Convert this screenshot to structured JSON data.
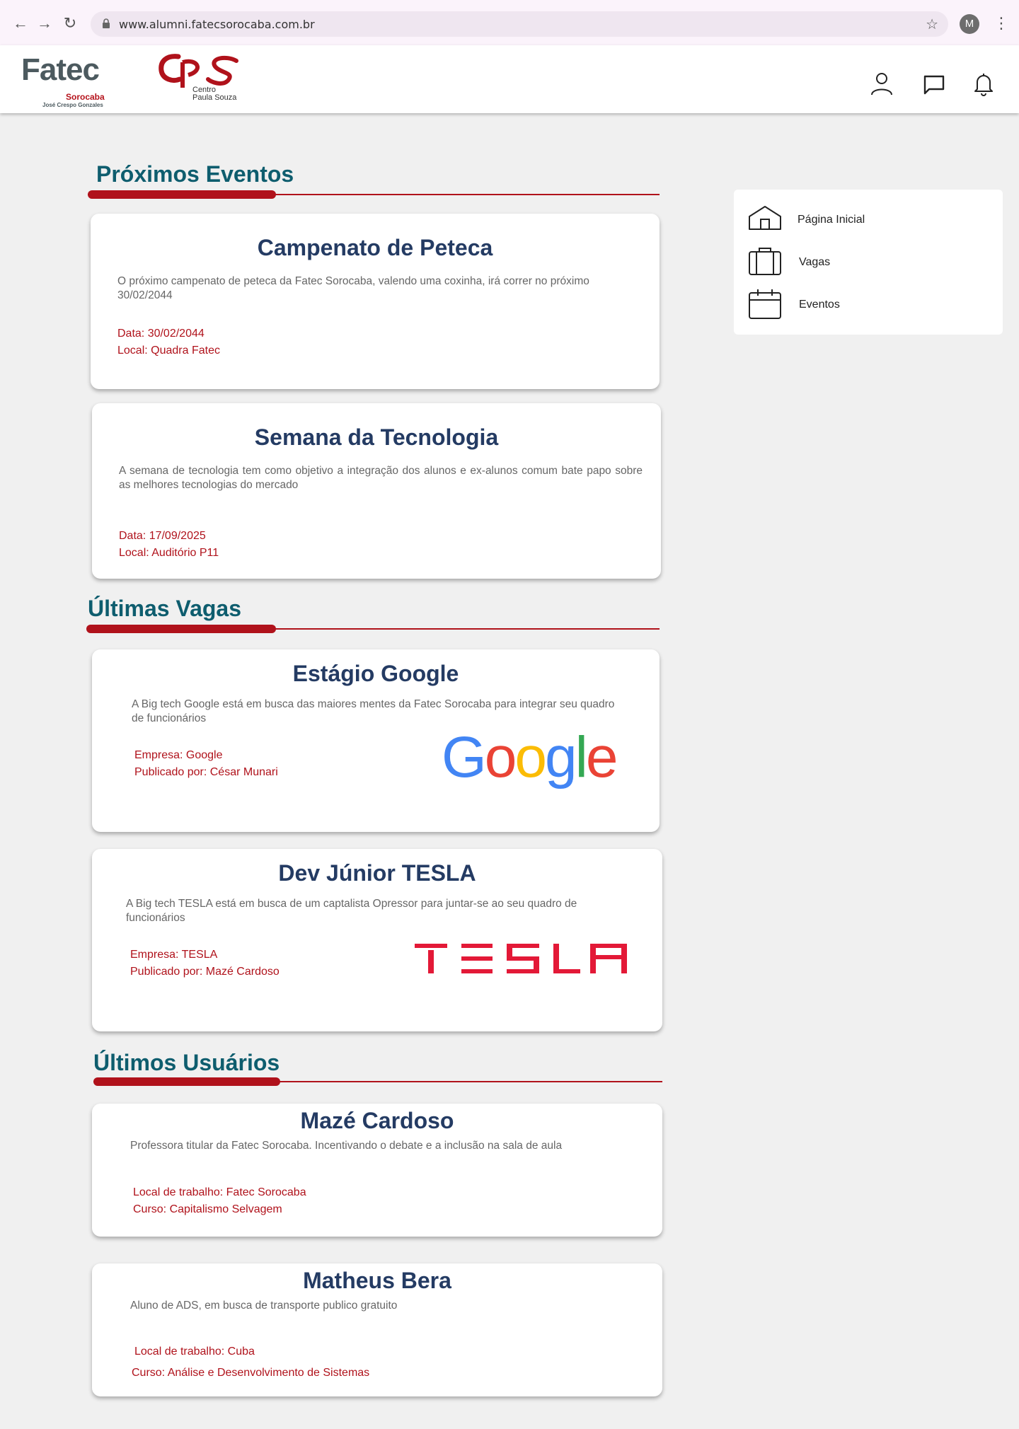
{
  "browser": {
    "url": "www.alumni.fatecsorocaba.com.br",
    "profile_initial": "M"
  },
  "header": {
    "fatec_logo_word": "Fatec",
    "fatec_logo_city": "Sorocaba",
    "fatec_logo_sub": "José Crespo Gonzales",
    "cps_logo_caption_1": "Centro",
    "cps_logo_caption_2": "Paula Souza",
    "icons": [
      "user-icon",
      "chat-icon",
      "bell-icon"
    ]
  },
  "sidebar": {
    "items": [
      {
        "label": "Página Inicial",
        "icon": "home-icon"
      },
      {
        "label": "Vagas",
        "icon": "briefcase-icon"
      },
      {
        "label": "Eventos",
        "icon": "calendar-icon"
      }
    ]
  },
  "events": {
    "title": "Próximos Eventos",
    "items": [
      {
        "title": "Campenato de Peteca",
        "description": "O próximo campenato de peteca da Fatec Sorocaba, valendo uma coxinha, irá correr no próximo 30/02/2044",
        "date": "Data: 30/02/2044",
        "location": "Local: Quadra Fatec"
      },
      {
        "title": "Semana da Tecnologia",
        "description": "A semana de tecnologia tem como objetivo a integração dos alunos e ex-alunos comum bate papo sobre as melhores tecnologias do mercado",
        "date": "Data: 17/09/2025",
        "location": "Local: Auditório P11"
      }
    ]
  },
  "jobs": {
    "title": "Últimas Vagas",
    "items": [
      {
        "title": "Estágio Google",
        "description": "A Big tech Google está em busca das maiores mentes da Fatec Sorocaba para integrar seu quadro de funcionários",
        "company": "Empresa: Google",
        "published_by": "Publicado por: César Munari",
        "logo_text": "Google"
      },
      {
        "title": "Dev Júnior TESLA",
        "description": "A Big tech TESLA está em busca de um captalista Opressor para juntar-se ao seu quadro de funcionários",
        "company": "Empresa: TESLA",
        "published_by": "Publicado por: Mazé Cardoso",
        "logo_text": "TESLA"
      }
    ]
  },
  "users": {
    "title": "Últimos Usuários",
    "items": [
      {
        "name": "Mazé Cardoso",
        "bio": "Professora titular da Fatec Sorocaba. Incentivando o debate e a inclusão na sala de aula",
        "workplace": "Local de trabalho: Fatec Sorocaba",
        "course": "Curso: Capitalismo Selvagem"
      },
      {
        "name": "Matheus Bera",
        "bio": "Aluno de ADS, em busca de transporte publico gratuito",
        "workplace": "Local de trabalho: Cuba",
        "course": "Curso: Análise e Desenvolvimento de Sistemas"
      }
    ]
  },
  "colors": {
    "accent_red": "#b0121b",
    "title_teal": "#0e5d6e",
    "card_title_navy": "#243b63",
    "google_blue": "#4285F4",
    "google_red": "#EA4335",
    "google_yellow": "#FBBC05",
    "google_green": "#34A853",
    "tesla_red": "#e31937"
  }
}
